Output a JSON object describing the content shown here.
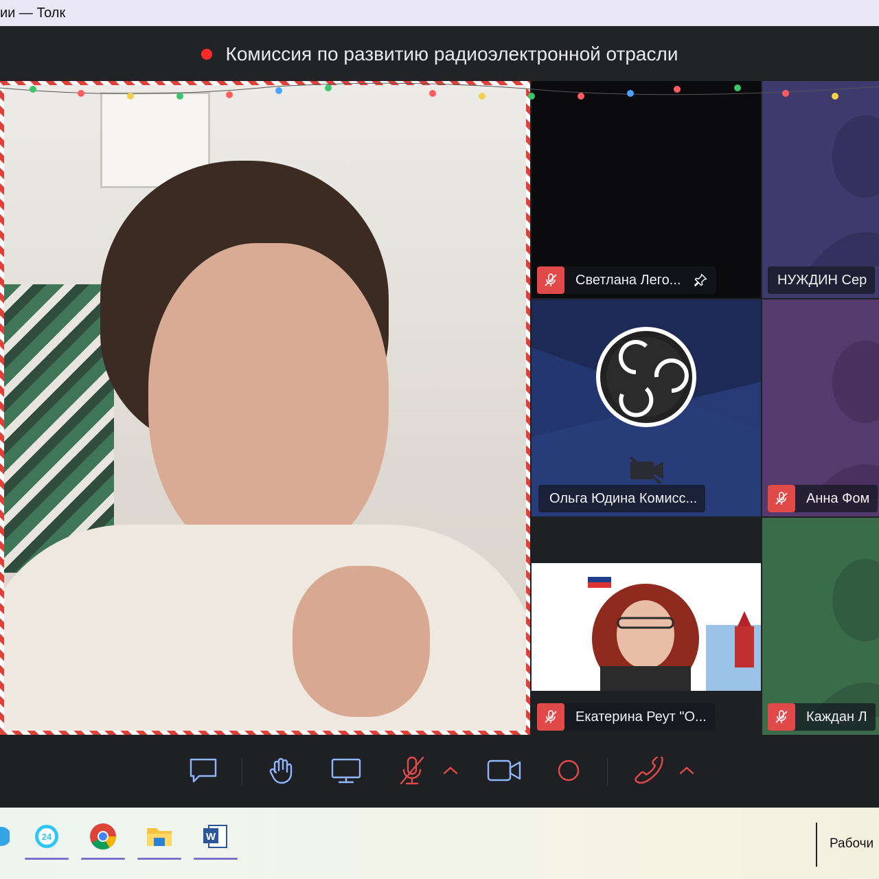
{
  "window": {
    "title": "ии — Толк"
  },
  "meeting": {
    "title": "Комиссия по развитию радиоэлектронной отрасли",
    "recording": true
  },
  "participants": [
    {
      "name": "Светлана Лего...",
      "muted": true,
      "pinned": true
    },
    {
      "name": "НУЖДИН Сер",
      "muted": false
    },
    {
      "name": "Ольга Юдина Комисс...",
      "muted": false,
      "camera_off": true
    },
    {
      "name": "Анна Фом",
      "muted": true
    },
    {
      "name": "Екатерина Реут \"О...",
      "muted": true
    },
    {
      "name": "Каждан Л",
      "muted": true
    }
  ],
  "controls": [
    "chat-icon",
    "raise-hand-icon",
    "screen-share-icon",
    "microphone-off-icon",
    "chevron-up-icon",
    "camera-icon",
    "record-icon",
    "hang-up-icon",
    "chevron-up-icon"
  ],
  "taskbar": {
    "apps": [
      "bitrix24-icon",
      "chrome-icon",
      "file-explorer-icon",
      "word-icon"
    ],
    "desktop_label": "Рабочи"
  },
  "colors": {
    "accent_red": "#e24a4a",
    "background": "#1f2024"
  }
}
